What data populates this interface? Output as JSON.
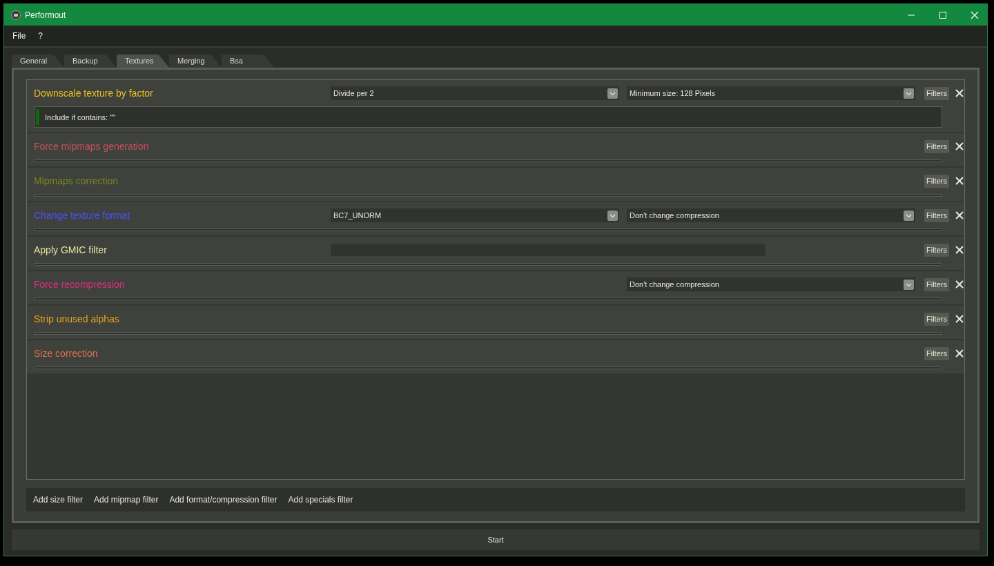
{
  "window": {
    "title": "Performout"
  },
  "menu": [
    "File",
    "?"
  ],
  "tabs": [
    {
      "label": "General",
      "selected": false
    },
    {
      "label": "Backup",
      "selected": false
    },
    {
      "label": "Textures",
      "selected": true
    },
    {
      "label": "Merging",
      "selected": false
    },
    {
      "label": "Bsa",
      "selected": false
    }
  ],
  "operations": [
    {
      "title": "Downscale texture by factor",
      "color": "#e8c020",
      "left": {
        "kind": "combo",
        "value": "Divide per 2"
      },
      "right": {
        "kind": "combo",
        "value": "Minimum size: 128 Pixels"
      },
      "filter_button": "Filters",
      "filters": [
        "Include if contains: \"\""
      ]
    },
    {
      "title": "Force mipmaps generation",
      "color": "#c85060",
      "filter_button": "Filters"
    },
    {
      "title": "Mipmaps correction",
      "color": "#7a8a20",
      "filter_button": "Filters"
    },
    {
      "title": "Change texture format",
      "color": "#5050ff",
      "left": {
        "kind": "combo",
        "value": "BC7_UNORM"
      },
      "right": {
        "kind": "combo",
        "value": "Don't change compression"
      },
      "filter_button": "Filters"
    },
    {
      "title": "Apply GMIC filter",
      "color": "#e8e0a0",
      "left": {
        "kind": "field"
      },
      "filter_button": "Filters"
    },
    {
      "title": "Force recompression",
      "color": "#e03080",
      "right": {
        "kind": "combo",
        "value": "Don't change compression"
      },
      "filter_button": "Filters"
    },
    {
      "title": "Strip unused alphas",
      "color": "#e8a020",
      "filter_button": "Filters"
    },
    {
      "title": "Size correction",
      "color": "#e07050",
      "filter_button": "Filters"
    }
  ],
  "add_buttons": [
    "Add size filter",
    "Add mipmap filter",
    "Add format/compression filter",
    "Add specials filter"
  ],
  "start_button": "Start"
}
